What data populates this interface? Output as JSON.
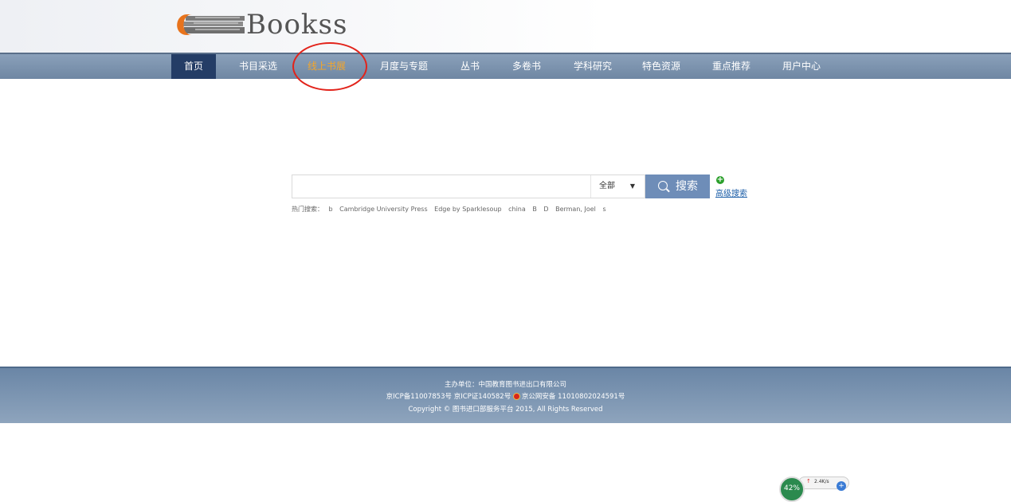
{
  "app": {
    "logo_text": "Bookss"
  },
  "nav": {
    "items": [
      {
        "label": "首页",
        "state": "active"
      },
      {
        "label": "书目采选",
        "state": "normal"
      },
      {
        "label": "线上书展",
        "state": "highlight"
      },
      {
        "label": "月度与专题",
        "state": "normal"
      },
      {
        "label": "丛书",
        "state": "normal"
      },
      {
        "label": "多卷书",
        "state": "normal"
      },
      {
        "label": "学科研究",
        "state": "normal"
      },
      {
        "label": "特色资源",
        "state": "normal"
      },
      {
        "label": "重点推荐",
        "state": "normal"
      },
      {
        "label": "用户中心",
        "state": "normal"
      }
    ]
  },
  "search": {
    "value": "",
    "scope_selected": "全部",
    "button_label": "搜索",
    "advanced_label": "高级搜索",
    "hot_label": "热门搜索：",
    "hot_terms": [
      "b",
      "Cambridge University Press",
      "Edge by Sparklesoup",
      "china",
      "B",
      "D",
      "Berman, Joel",
      "s"
    ]
  },
  "footer": {
    "host": "主办单位：中国教育图书进出口有限公司",
    "icp1": "京ICP备11007853号",
    "icp2": "京ICP证140582号",
    "police": "京公网安备 11010802024591号",
    "copyright": "Copyright © 图书进口部服务平台 2015, All Rights Reserved"
  },
  "widget": {
    "percent": "42%",
    "speed": "2.4K/s",
    "plus": "+"
  },
  "colors": {
    "nav_active": "#243d66",
    "nav_highlight": "#f4a62a",
    "annotation": "#e2231a",
    "search_button": "#6e8db8"
  }
}
